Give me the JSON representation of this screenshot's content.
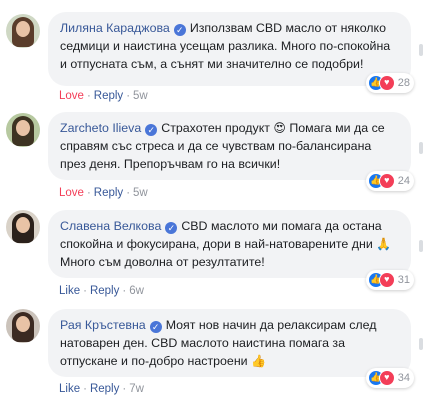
{
  "comments": [
    {
      "author": "Лиляна Караджова",
      "text": "Използвам CBD масло от няколко седмици и наистина усещам разлика. Много по-спокойна и отпусната съм, а сънят ми значително се подобри!",
      "reaction_count": "28",
      "action_primary": "Love",
      "reply_label": "Reply",
      "time": "5w",
      "avatar_colors": {
        "bg": "#cfd8c4",
        "hair": "#5a3d2b"
      }
    },
    {
      "author": "Zarcheto Ilieva",
      "text_before_emoji": "Страхотен продукт ",
      "emoji": "😍",
      "text": " Помага ми да се справям със стреса и да се чувствам по-балансирана през деня. Препоръчвам го на всички!",
      "reaction_count": "24",
      "action_primary": "Love",
      "reply_label": "Reply",
      "time": "5w",
      "avatar_colors": {
        "bg": "#b7c9a0",
        "hair": "#3d3322"
      }
    },
    {
      "author": "Славена Велкова",
      "text": "CBD маслото ми помага да остана спокойна и фокусирана, дори в най-натоварените дни",
      "emoji": "🙏",
      "text_after_emoji": " Много съм доволна от резултатите!",
      "reaction_count": "31",
      "action_primary": "Like",
      "reply_label": "Reply",
      "time": "6w",
      "avatar_colors": {
        "bg": "#d9d2c8",
        "hair": "#2b211b"
      }
    },
    {
      "author": "Рая Кръстевна",
      "text": "Моят нов начин да релаксирам след натоварен ден. CBD маслото наистина помага за отпускане и по-добро настроени",
      "emoji": "👍",
      "reaction_count": "34",
      "action_primary": "Like",
      "reply_label": "Reply",
      "time": "7w",
      "avatar_colors": {
        "bg": "#cbc3bb",
        "hair": "#3b2a22"
      }
    }
  ],
  "icons": {
    "verified": "verified-badge-icon",
    "like": "like-reaction-icon",
    "love": "love-reaction-icon"
  },
  "colors": {
    "link": "#385898",
    "love": "#f33e58",
    "like": "#1877f2",
    "bubble": "#f2f3f5"
  }
}
